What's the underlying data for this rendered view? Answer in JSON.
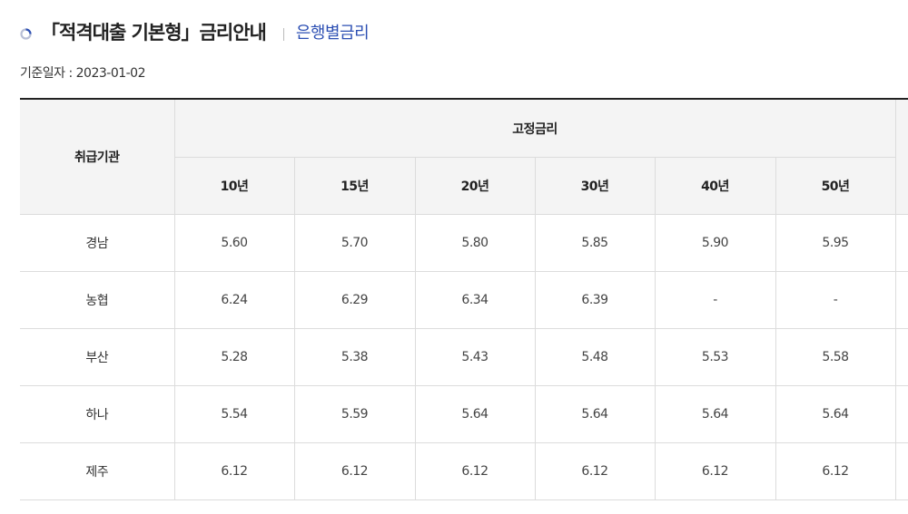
{
  "header": {
    "title": "「적격대출 기본형」금리안내",
    "bank_link": "은행별금리"
  },
  "base_date": "기준일자 : 2023-01-02",
  "table": {
    "institution_header": "취급기관",
    "group_header": "고정금리",
    "terms": [
      "10년",
      "15년",
      "20년",
      "30년",
      "40년",
      "50년"
    ],
    "rows": [
      {
        "bank": "경남",
        "rates": [
          "5.60",
          "5.70",
          "5.80",
          "5.85",
          "5.90",
          "5.95"
        ]
      },
      {
        "bank": "농협",
        "rates": [
          "6.24",
          "6.29",
          "6.34",
          "6.39",
          "-",
          "-"
        ]
      },
      {
        "bank": "부산",
        "rates": [
          "5.28",
          "5.38",
          "5.43",
          "5.48",
          "5.53",
          "5.58"
        ]
      },
      {
        "bank": "하나",
        "rates": [
          "5.54",
          "5.59",
          "5.64",
          "5.64",
          "5.64",
          "5.64"
        ]
      },
      {
        "bank": "제주",
        "rates": [
          "6.12",
          "6.12",
          "6.12",
          "6.12",
          "6.12",
          "6.12"
        ]
      }
    ]
  },
  "icons": {
    "title_bullet": "circle-bullet-icon"
  },
  "colors": {
    "link": "#2c4fb3",
    "header_bg": "#f4f4f4",
    "border": "#dcdcdc"
  }
}
